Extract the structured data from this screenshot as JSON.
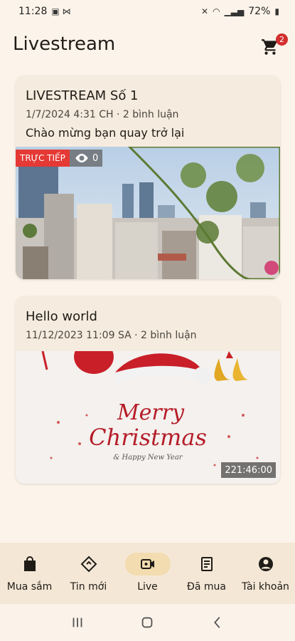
{
  "status": {
    "time": "11:28",
    "battery": "72%"
  },
  "header": {
    "title": "Livestream",
    "cart_count": "2"
  },
  "feed": [
    {
      "title": "LIVESTREAM Số 1",
      "meta": "1/7/2024 4:31 CH · 2 bình luận",
      "description": "Chào mừng bạn quay trở lại",
      "live_label": "TRỰC TIẾP",
      "views": "0"
    },
    {
      "title": "Hello world",
      "meta": "11/12/2023 11:09 SA · 2 bình luận",
      "merry": "Merry",
      "christmas": "Christmas",
      "happy": "& Happy New Year",
      "duration": "221:46:00"
    }
  ],
  "nav": {
    "items": [
      {
        "label": "Mua sắm",
        "icon": "shopping-bag-icon"
      },
      {
        "label": "Tin mới",
        "icon": "news-tag-icon"
      },
      {
        "label": "Live",
        "icon": "video-camera-icon"
      },
      {
        "label": "Đã mua",
        "icon": "receipt-icon"
      },
      {
        "label": "Tài khoản",
        "icon": "account-circle-icon"
      }
    ],
    "active_index": 2
  },
  "colors": {
    "background": "#fcf4ea",
    "card": "#f5ebde",
    "live_red": "#e53935",
    "active_pill": "#f2dcb0",
    "badge_red": "#d32f2f"
  }
}
